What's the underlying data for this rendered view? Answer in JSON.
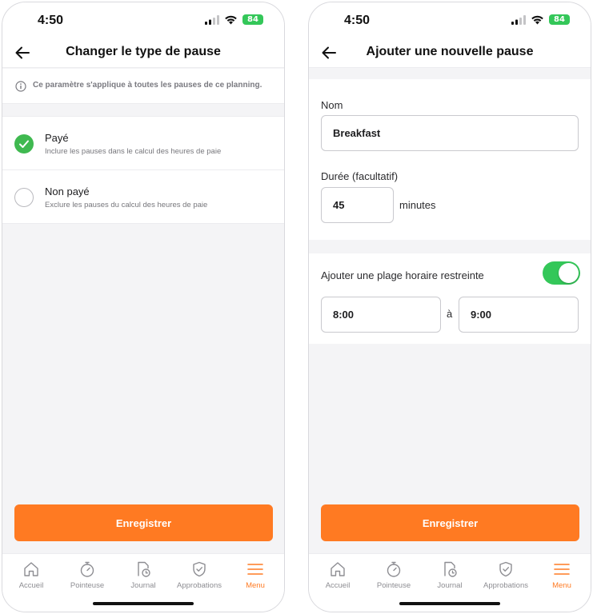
{
  "left": {
    "status": {
      "time": "4:50",
      "battery": "84"
    },
    "nav": {
      "title": "Changer le type de pause"
    },
    "info": {
      "text": "Ce paramètre s'applique à toutes les pauses de ce planning."
    },
    "options": [
      {
        "title": "Payé",
        "description": "Inclure les pauses dans le calcul des heures de paie",
        "selected": true
      },
      {
        "title": "Non payé",
        "description": "Exclure les pauses du calcul des heures de paie",
        "selected": false
      }
    ],
    "save_label": "Enregistrer"
  },
  "right": {
    "status": {
      "time": "4:50",
      "battery": "84"
    },
    "nav": {
      "title": "Ajouter une nouvelle pause"
    },
    "form": {
      "name_label": "Nom",
      "name_value": "Breakfast",
      "duration_label": "Durée (facultatif)",
      "duration_value": "45",
      "duration_unit": "minutes",
      "restrict_label": "Ajouter une plage horaire restreinte",
      "restrict_enabled": true,
      "start_time": "8:00",
      "to_label": "à",
      "end_time": "9:00"
    },
    "save_label": "Enregistrer"
  },
  "tabs": [
    {
      "label": "Accueil",
      "icon": "home-icon",
      "active": false
    },
    {
      "label": "Pointeuse",
      "icon": "stopwatch-icon",
      "active": false
    },
    {
      "label": "Journal",
      "icon": "timesheet-icon",
      "active": false
    },
    {
      "label": "Approbations",
      "icon": "shield-check-icon",
      "active": false
    },
    {
      "label": "Menu",
      "icon": "menu-icon",
      "active": true
    }
  ],
  "colors": {
    "accent": "#ff7a22",
    "success": "#3fb950",
    "toggle": "#34c759"
  }
}
